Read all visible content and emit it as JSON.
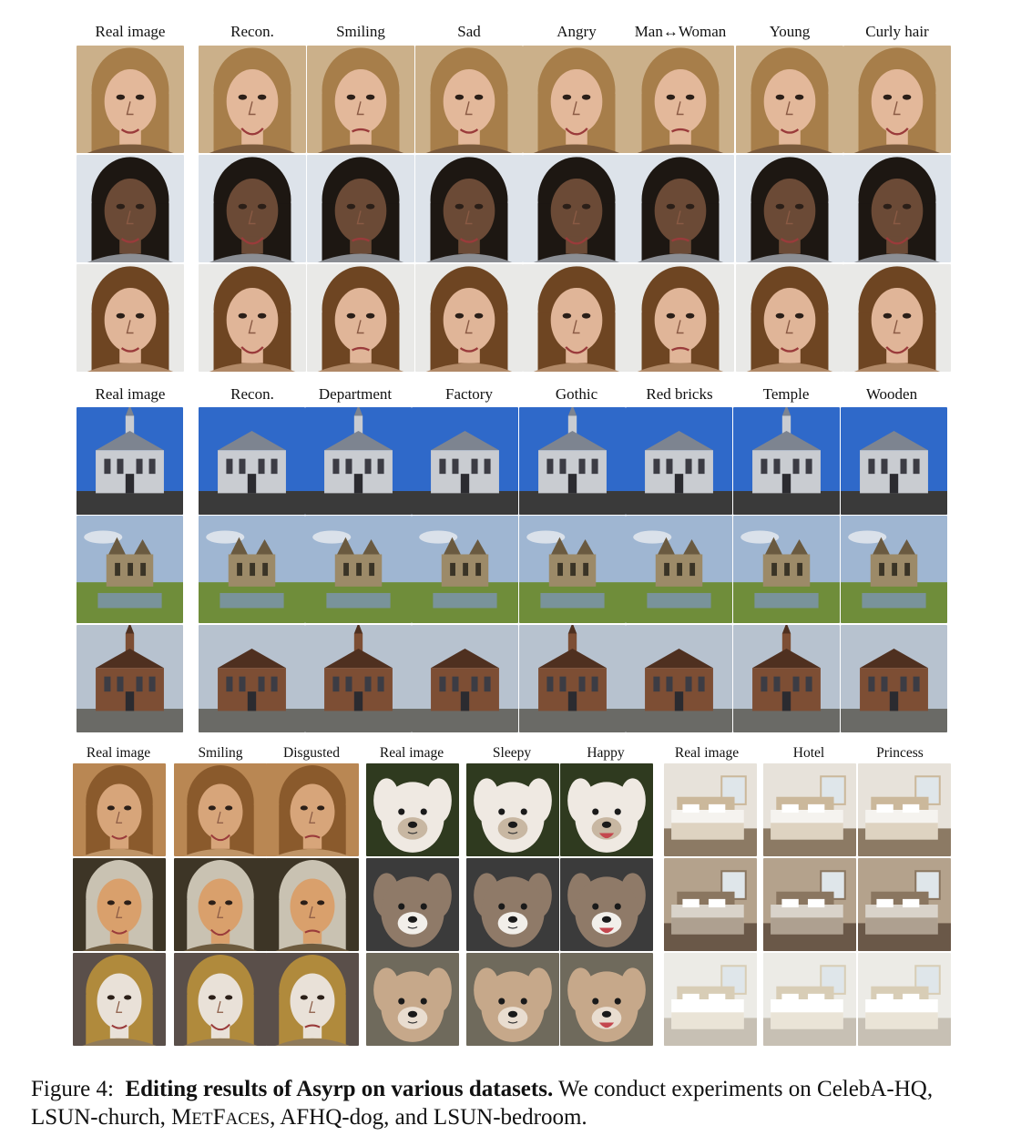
{
  "figure": {
    "sections": [
      {
        "id": "celeba",
        "headers": [
          "Real image",
          "Recon.",
          "Smiling",
          "Sad",
          "Angry",
          "Man↔Woman",
          "Young",
          "Curly hair"
        ],
        "rows": [
          {
            "subject": "face",
            "palette": {
              "bg": "#cbb08a",
              "hair": "#a77e4a",
              "skin": "#e3b89a",
              "cloth": "#7a5a3c"
            }
          },
          {
            "subject": "face",
            "palette": {
              "bg": "#dde3ea",
              "hair": "#1d1712",
              "skin": "#6b4a36",
              "cloth": "#8b8e94"
            }
          },
          {
            "subject": "face",
            "palette": {
              "bg": "#e9e9e7",
              "hair": "#6e4522",
              "skin": "#e0b598",
              "cloth": "#b08866"
            }
          }
        ]
      },
      {
        "id": "church",
        "headers": [
          "Real image",
          "Recon.",
          "Department",
          "Factory",
          "Gothic",
          "Red bricks",
          "Temple",
          "Wooden"
        ],
        "rows": [
          {
            "subject": "church",
            "palette": {
              "sky": "#2f69c9",
              "building": "#c9ccd1",
              "ground": "#3a3a3a",
              "roof": "#7d8490"
            }
          },
          {
            "subject": "ruin",
            "palette": {
              "sky": "#9fb6d2",
              "building": "#9c8a68",
              "ground": "#6f8d3a",
              "roof": "#6a5a40"
            }
          },
          {
            "subject": "church",
            "palette": {
              "sky": "#b7c2cf",
              "building": "#7d4e34",
              "ground": "#6a6a66",
              "roof": "#4f3020"
            }
          }
        ]
      },
      {
        "id": "misc",
        "groups": [
          {
            "headers": [
              "Real image",
              "Smiling",
              "Disgusted"
            ]
          },
          {
            "headers": [
              "Real image",
              "Sleepy",
              "Happy"
            ]
          },
          {
            "headers": [
              "Real image",
              "Hotel",
              "Princess"
            ]
          }
        ],
        "rows": [
          {
            "metfaces": {
              "bg": "#b98753",
              "hair": "#8a5a2c",
              "skin": "#d7a57a",
              "cloth": "#c09567"
            },
            "dog": {
              "bg": "#2f3a1f",
              "fur": "#efe9e2",
              "accent": "#c8b7a2"
            },
            "bedroom": {
              "wall": "#e7e2da",
              "bed": "#f5f3ef",
              "floor": "#8c7a64",
              "accent": "#cbb89b"
            }
          },
          {
            "metfaces": {
              "bg": "#3d3526",
              "hair": "#c9c2b2",
              "skin": "#d9a06c",
              "cloth": "#6c5a3e"
            },
            "dog": {
              "bg": "#3b3b3b",
              "fur": "#8f7a68",
              "accent": "#f2efea"
            },
            "bedroom": {
              "wall": "#b4a28c",
              "bed": "#d9d3ca",
              "floor": "#6a5848",
              "accent": "#8a7660"
            }
          },
          {
            "metfaces": {
              "bg": "#5a4f4a",
              "hair": "#b08a3c",
              "skin": "#e9e1d8",
              "cloth": "#8f7a5a"
            },
            "dog": {
              "bg": "#6f6a5c",
              "fur": "#c6a88a",
              "accent": "#e9ddd0"
            },
            "bedroom": {
              "wall": "#ecebe6",
              "bed": "#ffffff",
              "floor": "#c7c0b4",
              "accent": "#d8cdb6"
            }
          }
        ]
      }
    ],
    "caption": {
      "label": "Figure 4:",
      "title": "Editing results of Asyrp on various datasets.",
      "text_pre": "We conduct experiments on CelebA-HQ, LSUN-church,",
      "metfaces_m": "M",
      "metfaces_et": "ET",
      "metfaces_f": "F",
      "metfaces_aces": "ACES",
      "text_post": ", AFHQ-dog, and LSUN-bedroom."
    }
  }
}
